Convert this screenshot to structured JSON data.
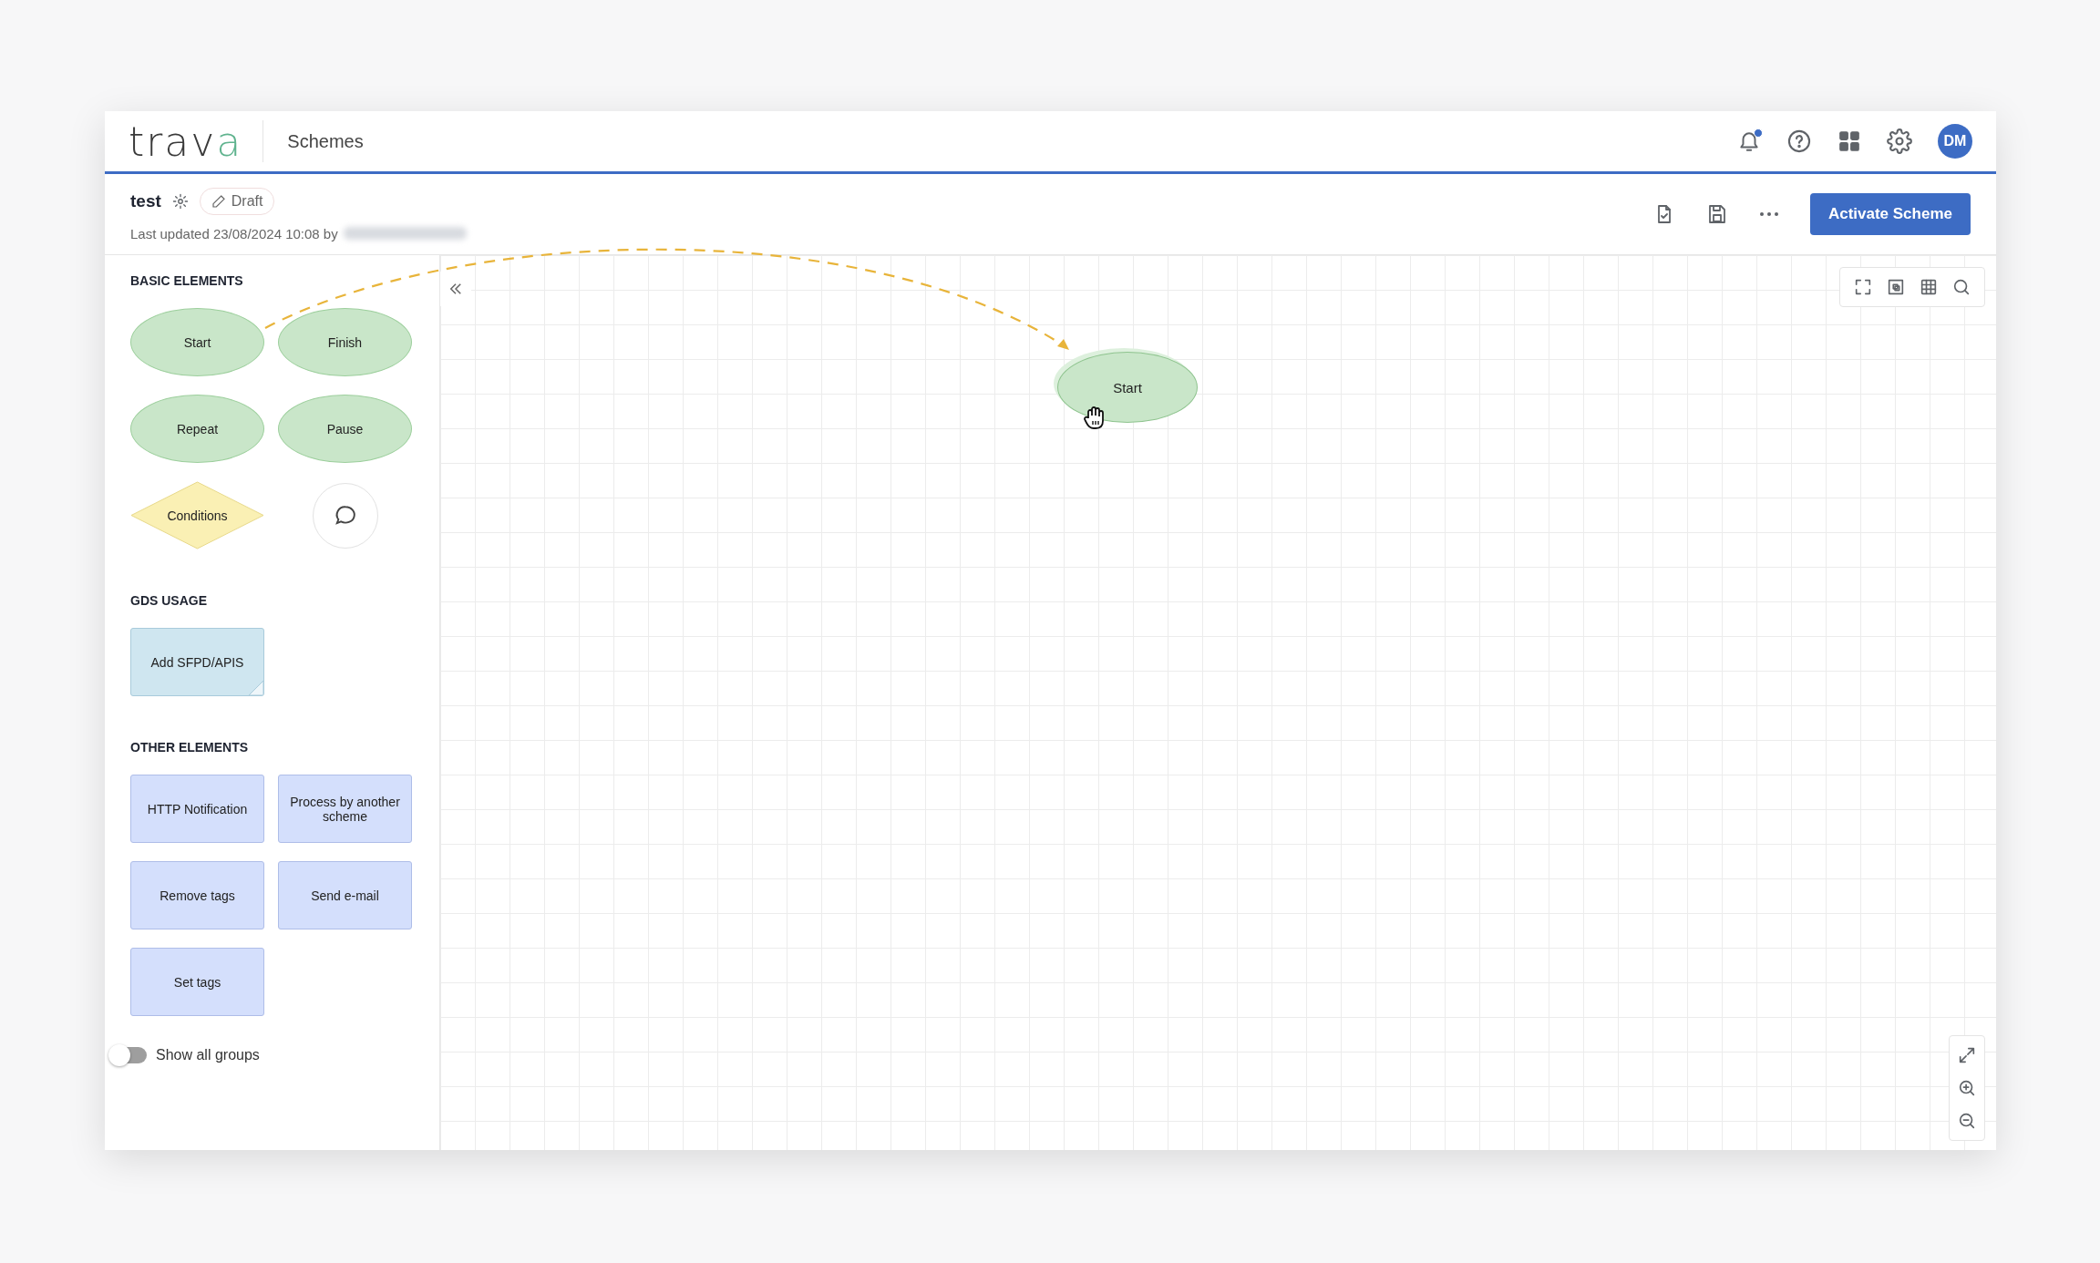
{
  "header": {
    "logo": {
      "text": "trav",
      "accent": "a"
    },
    "section": "Schemes",
    "notifications": {
      "unread": true
    },
    "avatar": "DM"
  },
  "scheme": {
    "name": "test",
    "status": "Draft",
    "updated": "Last updated 23/08/2024 10:08 by",
    "primary_action": "Activate Scheme"
  },
  "sidebar": {
    "groups": [
      {
        "title": "BASIC ELEMENTS",
        "items": [
          {
            "kind": "ellipse",
            "label": "Start"
          },
          {
            "kind": "ellipse",
            "label": "Finish"
          },
          {
            "kind": "ellipse",
            "label": "Repeat"
          },
          {
            "kind": "ellipse",
            "label": "Pause"
          },
          {
            "kind": "diamond",
            "label": "Conditions"
          },
          {
            "kind": "comment"
          }
        ]
      },
      {
        "title": "GDS USAGE",
        "items": [
          {
            "kind": "note",
            "label": "Add SFPD/APIS"
          }
        ]
      },
      {
        "title": "OTHER ELEMENTS",
        "items": [
          {
            "kind": "rect",
            "label": "HTTP Notification"
          },
          {
            "kind": "rect",
            "label": "Process by another scheme"
          },
          {
            "kind": "rect",
            "label": "Remove tags"
          },
          {
            "kind": "rect",
            "label": "Send e-mail"
          },
          {
            "kind": "rect",
            "label": "Set tags"
          }
        ]
      }
    ],
    "show_all_groups": {
      "label": "Show all groups",
      "on": false
    }
  },
  "canvas": {
    "nodes": [
      {
        "kind": "ellipse",
        "label": "Start"
      }
    ]
  }
}
